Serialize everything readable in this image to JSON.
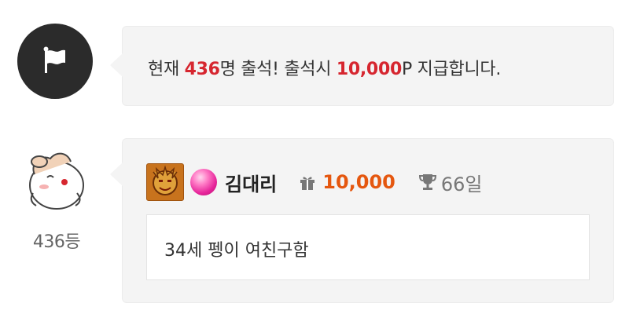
{
  "notice": {
    "icon": "flag-icon",
    "prefix": "현재 ",
    "count": "436",
    "middle": "명 출석! 출석시 ",
    "reward": "10,000",
    "suffix": "P 지급합니다."
  },
  "comment": {
    "avatar_icon": "smiling-character-avatar",
    "rank": "436등",
    "level_icon": "level-badge-icon",
    "gem_icon": "pink-gem-icon",
    "username": "김대리",
    "gift_icon": "gift-icon",
    "points": "10,000",
    "trophy_icon": "trophy-icon",
    "days": "66일",
    "message": "34세 펭이 여친구함"
  },
  "colors": {
    "highlight_red": "#d6262f",
    "points_orange": "#e5570f",
    "bubble_bg": "#f4f4f4",
    "icon_dark": "#2b2b2b"
  }
}
